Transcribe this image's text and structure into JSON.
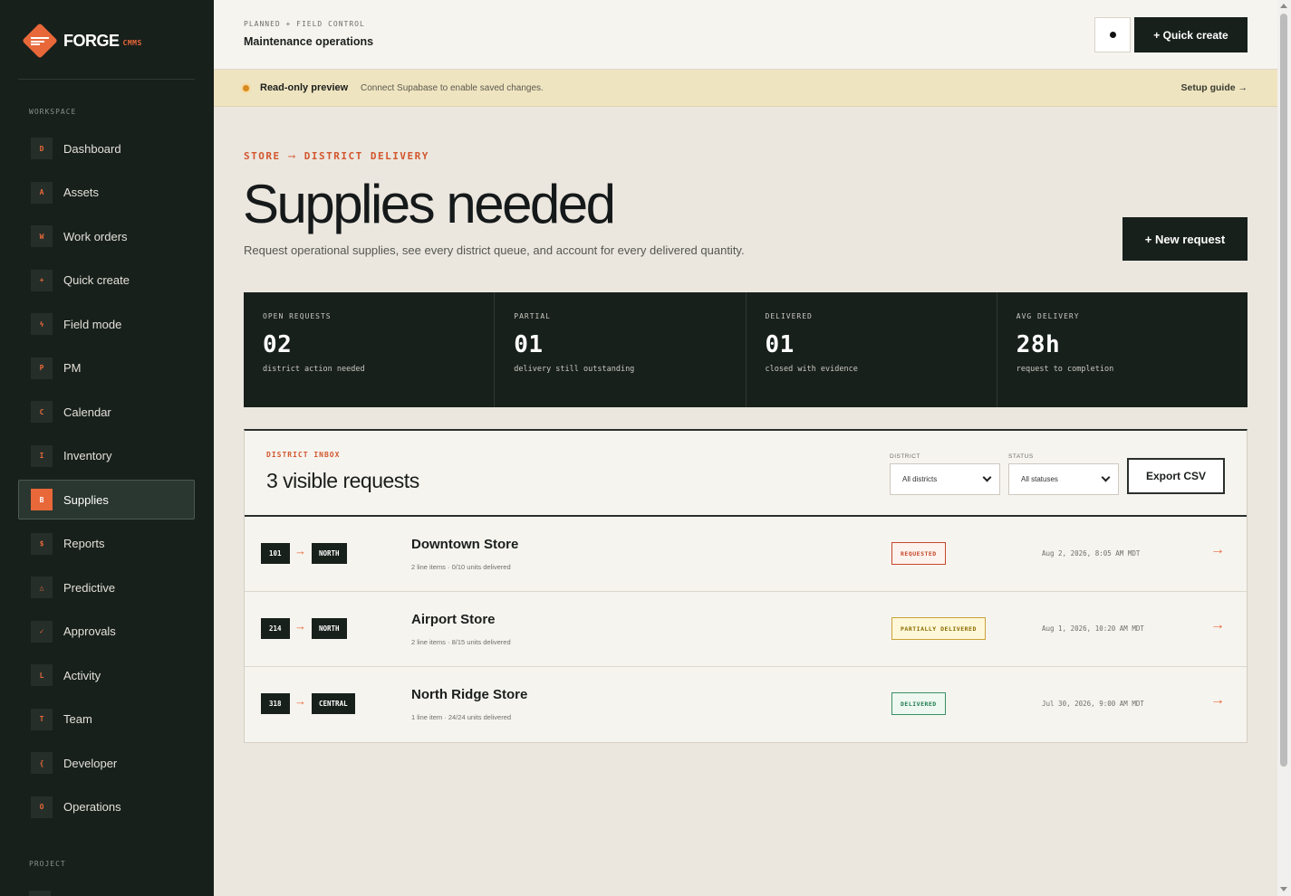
{
  "brand": {
    "name": "FORGE",
    "suffix": "CMMS"
  },
  "sidebar": {
    "section_workspace": "WORKSPACE",
    "section_project": "PROJECT",
    "items": [
      {
        "badge": "D",
        "label": "Dashboard",
        "slug": "dashboard"
      },
      {
        "badge": "A",
        "label": "Assets",
        "slug": "assets"
      },
      {
        "badge": "W",
        "label": "Work orders",
        "slug": "work-orders"
      },
      {
        "badge": "+",
        "label": "Quick create",
        "slug": "quick-create"
      },
      {
        "badge": "ϟ",
        "label": "Field mode",
        "slug": "field-mode"
      },
      {
        "badge": "P",
        "label": "PM",
        "slug": "pm"
      },
      {
        "badge": "C",
        "label": "Calendar",
        "slug": "calendar"
      },
      {
        "badge": "I",
        "label": "Inventory",
        "slug": "inventory"
      },
      {
        "badge": "B",
        "label": "Supplies",
        "slug": "supplies",
        "active": true
      },
      {
        "badge": "$",
        "label": "Reports",
        "slug": "reports"
      },
      {
        "badge": "△",
        "label": "Predictive",
        "slug": "predictive"
      },
      {
        "badge": "✓",
        "label": "Approvals",
        "slug": "approvals"
      },
      {
        "badge": "L",
        "label": "Activity",
        "slug": "activity"
      },
      {
        "badge": "T",
        "label": "Team",
        "slug": "team"
      },
      {
        "badge": "{",
        "label": "Developer",
        "slug": "developer"
      },
      {
        "badge": "O",
        "label": "Operations",
        "slug": "operations"
      }
    ]
  },
  "header": {
    "eyebrow": "PLANNED + FIELD CONTROL",
    "title": "Maintenance operations",
    "quick_create": "+ Quick create"
  },
  "banner": {
    "strong": "Read-only preview",
    "text": "Connect Supabase to enable saved changes.",
    "link": "Setup guide →"
  },
  "hero": {
    "crumb_from": "STORE",
    "crumb_arrow": "⟶",
    "crumb_to": "DISTRICT DELIVERY",
    "title": "Supplies needed",
    "subtitle": "Request operational supplies, see every district queue, and account for every delivered quantity.",
    "new_request": "+ New request"
  },
  "stats": [
    {
      "label": "OPEN REQUESTS",
      "value": "02",
      "note": "district action needed"
    },
    {
      "label": "PARTIAL",
      "value": "01",
      "note": "delivery still outstanding"
    },
    {
      "label": "DELIVERED",
      "value": "01",
      "note": "closed with evidence"
    },
    {
      "label": "AVG DELIVERY",
      "value": "28h",
      "note": "request to completion"
    }
  ],
  "inbox": {
    "eyebrow": "DISTRICT INBOX",
    "title": "3 visible requests",
    "district_label": "DISTRICT",
    "district_value": "All districts",
    "status_label": "STATUS",
    "status_value": "All statuses",
    "export": "Export CSV",
    "rows": [
      {
        "code": "101",
        "arrow": "→",
        "district": "NORTH",
        "store": "Downtown Store",
        "meta": "2 line items · 0/10 units delivered",
        "status": "REQUESTED",
        "status_kind": "req",
        "time": "Aug 2, 2026, 8:05 AM MDT",
        "go": "→"
      },
      {
        "code": "214",
        "arrow": "→",
        "district": "NORTH",
        "store": "Airport Store",
        "meta": "2 line items · 8/15 units delivered",
        "status": "PARTIALLY DELIVERED",
        "status_kind": "part",
        "time": "Aug 1, 2026, 10:20 AM MDT",
        "go": "→"
      },
      {
        "code": "318",
        "arrow": "→",
        "district": "CENTRAL",
        "store": "North Ridge Store",
        "meta": "1 line item · 24/24 units delivered",
        "status": "DELIVERED",
        "status_kind": "done",
        "time": "Jul 30, 2026, 9:00 AM MDT",
        "go": "→"
      }
    ]
  },
  "colors": {
    "accent": "#e8683a",
    "dark": "#18201c",
    "paper": "#f6f4ef",
    "banner": "#efe4c0"
  }
}
